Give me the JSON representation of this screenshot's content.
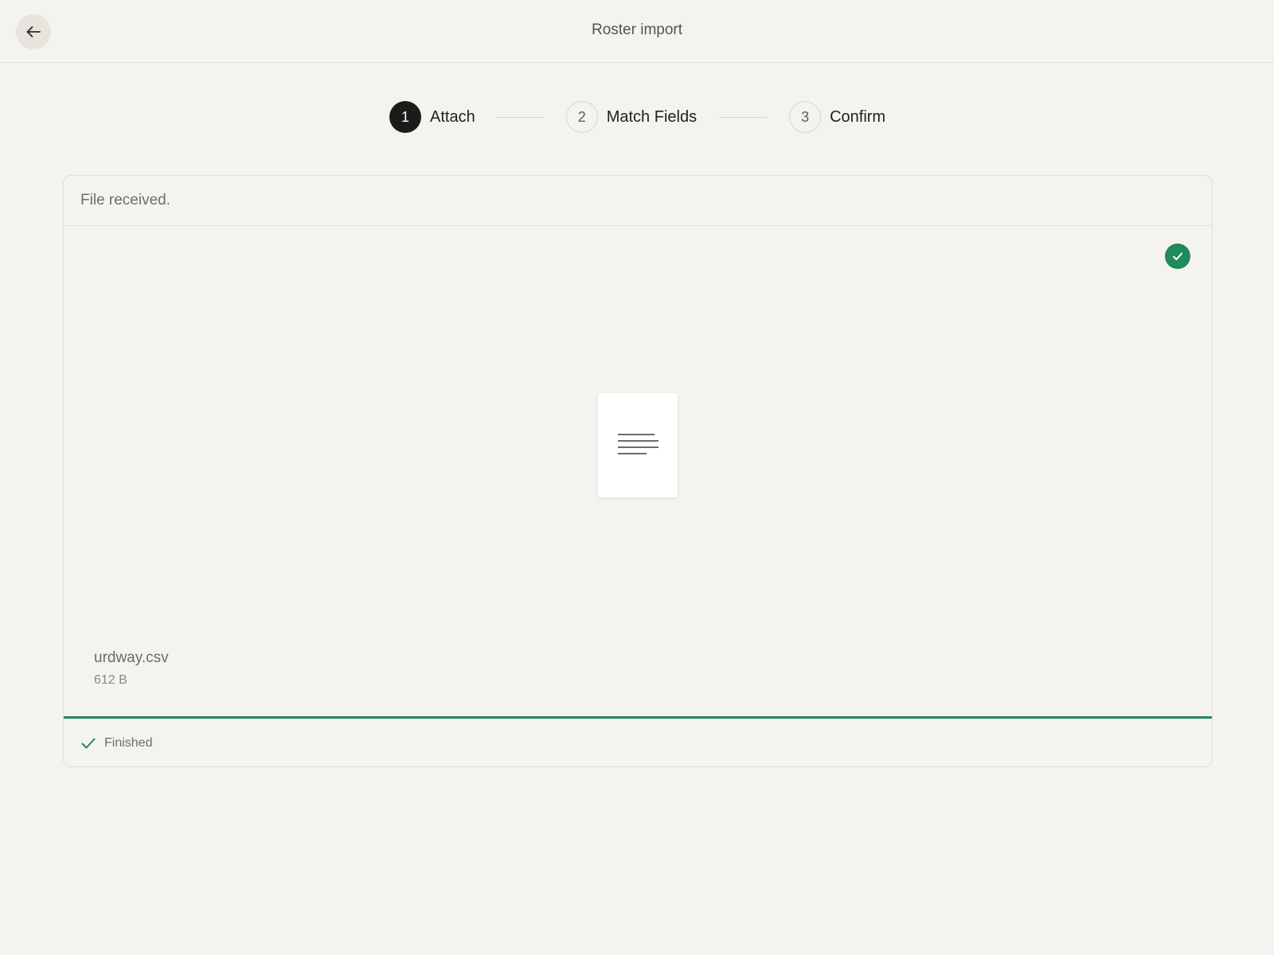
{
  "header": {
    "title": "Roster import",
    "back_icon": "arrow-left-icon"
  },
  "stepper": {
    "steps": [
      {
        "number": "1",
        "label": "Attach",
        "state": "active"
      },
      {
        "number": "2",
        "label": "Match Fields",
        "state": "upcoming"
      },
      {
        "number": "3",
        "label": "Confirm",
        "state": "upcoming"
      }
    ]
  },
  "upload": {
    "heading": "File received.",
    "file_name": "urdway.csv",
    "file_size": "612 B",
    "progress_percent": 100,
    "status_label": "Finished",
    "status_icon": "check-icon",
    "badge_icon": "check-circle-icon",
    "preview_icon": "document-lines-icon"
  },
  "colors": {
    "background": "#f4f3ef",
    "accent_success": "#1f8a5b",
    "active_step": "#1c1b19"
  }
}
